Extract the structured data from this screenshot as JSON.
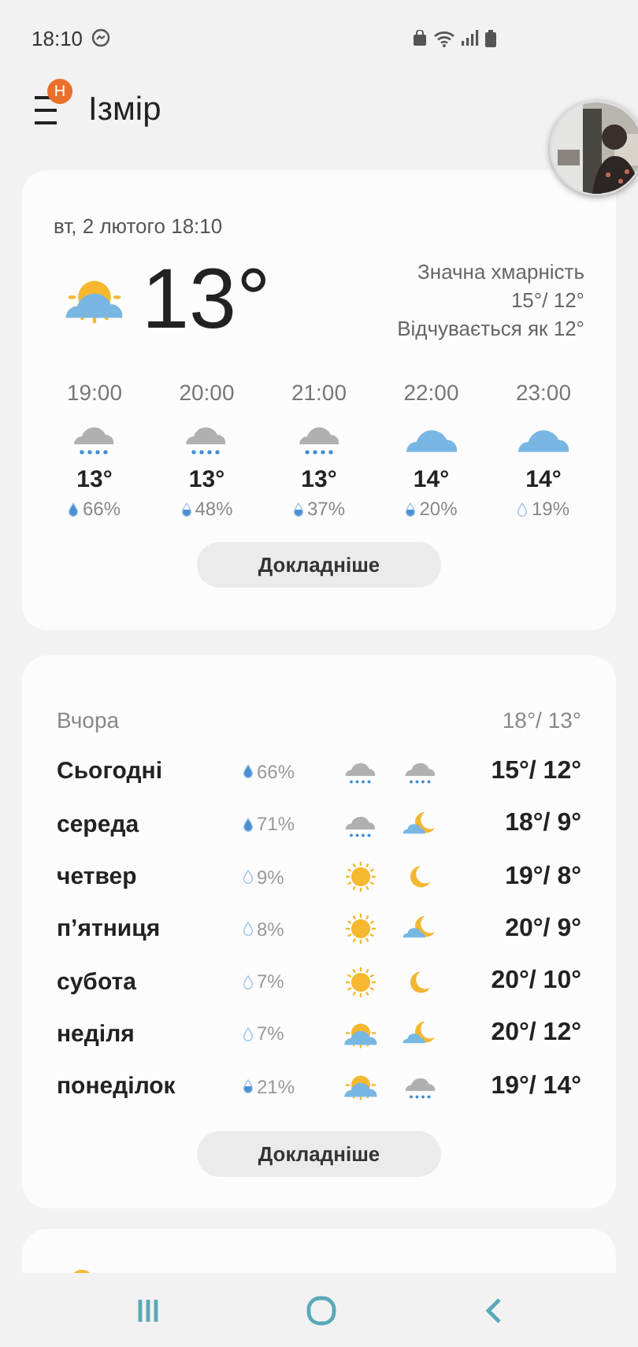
{
  "status_bar": {
    "time": "18:10"
  },
  "header": {
    "city": "Ізмір",
    "badge": "Н"
  },
  "current": {
    "date": "вт, 2 лютого 18:10",
    "temp": "13°",
    "condition": "Значна хмарність",
    "range": "15°/ 12°",
    "feels_like": "Відчувається як 12°"
  },
  "hourly": [
    {
      "time": "19:00",
      "temp": "13°",
      "precip": "66%"
    },
    {
      "time": "20:00",
      "temp": "13°",
      "precip": "48%"
    },
    {
      "time": "21:00",
      "temp": "13°",
      "precip": "37%"
    },
    {
      "time": "22:00",
      "temp": "14°",
      "precip": "20%"
    },
    {
      "time": "23:00",
      "temp": "14°",
      "precip": "19%"
    }
  ],
  "current_button": "Докладніше",
  "yesterday": {
    "label": "Вчора",
    "temps": "18°/ 13°"
  },
  "daily": [
    {
      "day": "Сьогодні",
      "precip": "66%",
      "temps": "15°/ 12°"
    },
    {
      "day": "середа",
      "precip": "71%",
      "temps": "18°/ 9°"
    },
    {
      "day": "четвер",
      "precip": "9%",
      "temps": "19°/ 8°"
    },
    {
      "day": "п’ятниця",
      "precip": "8%",
      "temps": "20°/ 9°"
    },
    {
      "day": "субота",
      "precip": "7%",
      "temps": "20°/ 10°"
    },
    {
      "day": "неділя",
      "precip": "7%",
      "temps": "20°/ 12°"
    },
    {
      "day": "понеділок",
      "precip": "21%",
      "temps": "19°/ 14°"
    }
  ],
  "daily_button": "Докладніше"
}
